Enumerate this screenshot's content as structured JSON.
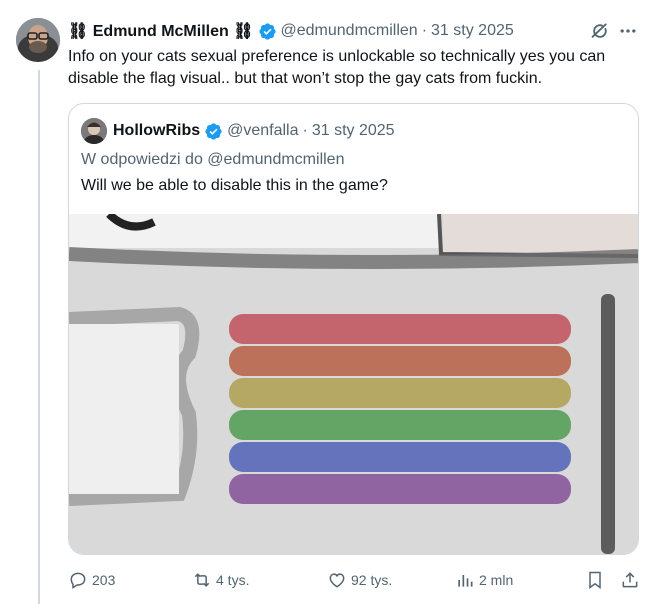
{
  "tweet": {
    "author_name": "⛓ Edmund McMillen ⛓",
    "handle": "@edmundmcmillen",
    "separator": "·",
    "date": "31 sty 2025",
    "text": "Info on your cats sexual preference is unlockable so technically yes you can disable the flag visual.. but that won’t stop the gay cats from fuckin."
  },
  "quote": {
    "author_name": "HollowRibs",
    "handle": "@venfalla",
    "separator": "·",
    "date": "31 sty 2025",
    "replying_to": "W odpowiedzi do @edmundmcmillen",
    "text": "Will we be able to disable this in the game?",
    "media_colors": [
      "#c25a64",
      "#b8684f",
      "#b2a45a",
      "#5aa05a",
      "#5a6ab8",
      "#8a5a9c"
    ]
  },
  "actions": {
    "replies": "203",
    "reposts": "4 tys.",
    "likes": "92 tys.",
    "views": "2 mln"
  },
  "icons": [
    "verified-badge-icon",
    "grok-icon",
    "more-icon",
    "reply-icon",
    "repost-icon",
    "like-icon",
    "views-icon",
    "bookmark-icon",
    "share-icon"
  ],
  "colors": {
    "verified": "#1d9bf0",
    "secondary_text": "#536471",
    "border": "#cfd9de"
  }
}
